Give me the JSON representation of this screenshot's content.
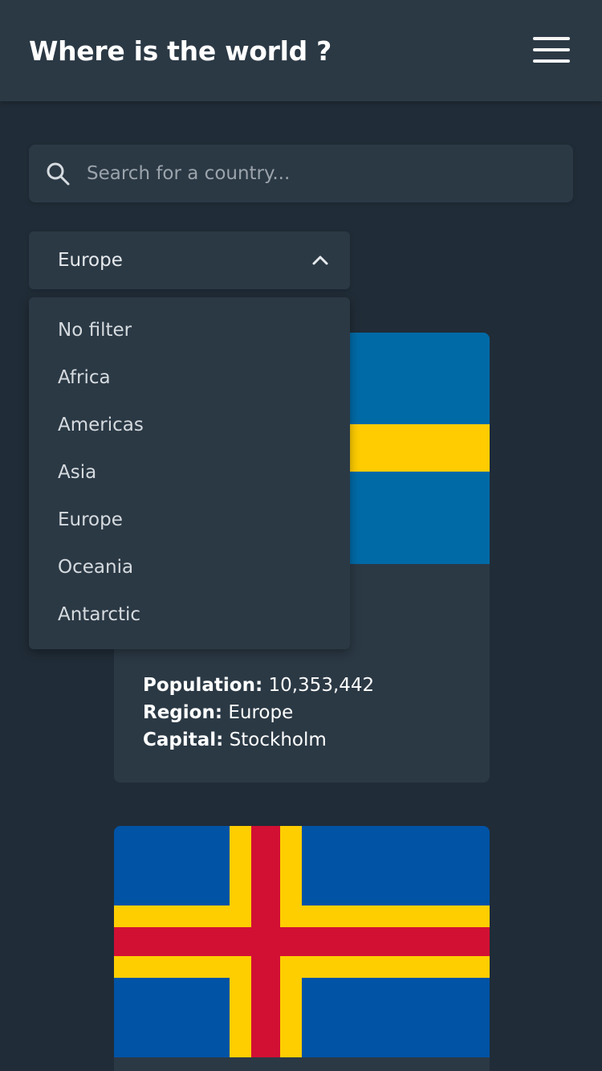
{
  "header": {
    "title": "Where is the world ?",
    "menu_icon": "hamburger-menu-icon"
  },
  "search": {
    "placeholder": "Search for a country...",
    "value": "",
    "icon": "search-icon"
  },
  "filter": {
    "selected": "Europe",
    "expanded": true,
    "options": [
      "No filter",
      "Africa",
      "Americas",
      "Asia",
      "Europe",
      "Oceania",
      "Antarctic"
    ]
  },
  "countries": [
    {
      "flag": "sweden-flag",
      "population_label": "Population:",
      "population": "10,353,442",
      "region_label": "Region:",
      "region": "Europe",
      "capital_label": "Capital:",
      "capital": "Stockholm"
    },
    {
      "flag": "aland-flag"
    }
  ],
  "colors": {
    "background": "#202c37",
    "surface": "#2b3945",
    "text": "#ffffff",
    "sweden_blue": "#006aa7",
    "sweden_yellow": "#fecc00",
    "aland_blue": "#0053a5",
    "aland_yellow": "#ffce00",
    "aland_red": "#d21034"
  }
}
